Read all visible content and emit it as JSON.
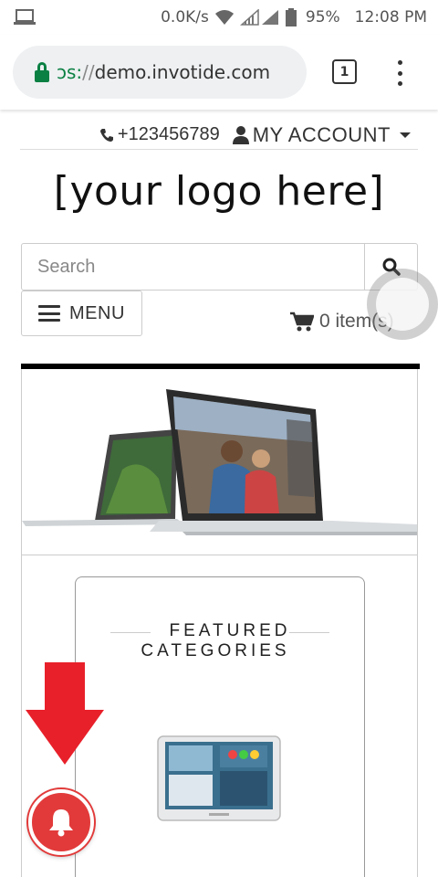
{
  "status_bar": {
    "speed": "0.0K/s",
    "battery": "95%",
    "time": "12:08 PM"
  },
  "browser": {
    "url_scheme": "ɔs:",
    "url_sep": "//",
    "url_host": "demo.invotide.com",
    "tab_count": "1"
  },
  "topbar": {
    "phone": "+123456789",
    "account": "MY ACCOUNT"
  },
  "logo": {
    "text": "[your logo here]"
  },
  "search": {
    "placeholder": "Search"
  },
  "menu": {
    "label": "MENU"
  },
  "cart": {
    "label": "0 item(s)"
  },
  "featured": {
    "line1": "FEATURED",
    "line2": "CATEGORIES"
  },
  "colors": {
    "accent_red": "#e23a3a",
    "secure_green": "#0b8043",
    "border": "#cccccc"
  },
  "icons": [
    "laptop-icon",
    "wifi-icon",
    "signal-icon",
    "battery-icon",
    "lock-icon",
    "tabs-icon",
    "more-icon",
    "phone-icon",
    "user-icon",
    "search-icon",
    "hamburger-icon",
    "cart-icon",
    "arrow-down-icon",
    "bell-icon"
  ]
}
